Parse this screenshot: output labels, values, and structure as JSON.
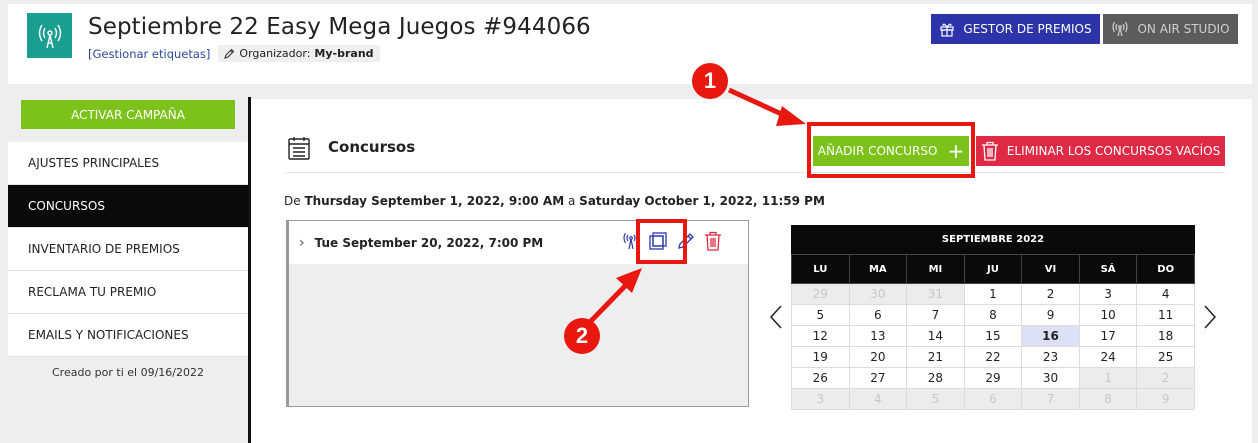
{
  "header": {
    "title": "Septiembre 22 Easy Mega Juegos #944066",
    "manage_tags": "[Gestionar etiquetas]",
    "organizer_label": "Organizador:",
    "organizer_name": "My-brand",
    "prize_manager_label": "GESTOR DE PREMIOS",
    "on_air_label": "ON AIR STUDIO",
    "logo_icon": "broadcast-tower-icon"
  },
  "sidebar": {
    "activate_label": "ACTIVAR CAMPAÑA",
    "items": [
      {
        "label": "AJUSTES PRINCIPALES",
        "active": false
      },
      {
        "label": "CONCURSOS",
        "active": true
      },
      {
        "label": "INVENTARIO DE PREMIOS",
        "active": false
      },
      {
        "label": "RECLAMA TU PREMIO",
        "active": false
      },
      {
        "label": "EMAILS Y NOTIFICACIONES",
        "active": false
      }
    ],
    "created": "Creado por ti el 09/16/2022"
  },
  "main": {
    "section_title": "Concursos",
    "add_contest_label": "AÑADIR CONCURSO",
    "delete_empty_label": "ELIMINAR LOS CONCURSOS VACÍOS",
    "range_prefix": "De",
    "range_start": "Thursday September 1, 2022, 9:00 AM",
    "range_mid": "a",
    "range_end": "Saturday October 1, 2022, 11:59 PM",
    "contest": {
      "date": "Tue September 20, 2022, 7:00 PM",
      "icons": [
        "broadcast-icon",
        "duplicate-icon",
        "edit-pencil-icon",
        "trash-icon"
      ]
    }
  },
  "calendar": {
    "title": "SEPTIEMBRE 2022",
    "weekdays": [
      "LU",
      "MA",
      "MI",
      "JU",
      "VI",
      "SÁ",
      "DO"
    ],
    "today": "16",
    "weeks": [
      [
        {
          "d": "29",
          "o": true
        },
        {
          "d": "30",
          "o": true
        },
        {
          "d": "31",
          "o": true
        },
        {
          "d": "1"
        },
        {
          "d": "2"
        },
        {
          "d": "3"
        },
        {
          "d": "4"
        }
      ],
      [
        {
          "d": "5"
        },
        {
          "d": "6"
        },
        {
          "d": "7"
        },
        {
          "d": "8"
        },
        {
          "d": "9"
        },
        {
          "d": "10"
        },
        {
          "d": "11"
        }
      ],
      [
        {
          "d": "12"
        },
        {
          "d": "13"
        },
        {
          "d": "14"
        },
        {
          "d": "15"
        },
        {
          "d": "16"
        },
        {
          "d": "17"
        },
        {
          "d": "18"
        }
      ],
      [
        {
          "d": "19"
        },
        {
          "d": "20"
        },
        {
          "d": "21"
        },
        {
          "d": "22"
        },
        {
          "d": "23"
        },
        {
          "d": "24"
        },
        {
          "d": "25"
        }
      ],
      [
        {
          "d": "26"
        },
        {
          "d": "27"
        },
        {
          "d": "28"
        },
        {
          "d": "29"
        },
        {
          "d": "30"
        },
        {
          "d": "1",
          "o": true
        },
        {
          "d": "2",
          "o": true
        }
      ],
      [
        {
          "d": "3",
          "o": true
        },
        {
          "d": "4",
          "o": true
        },
        {
          "d": "5",
          "o": true
        },
        {
          "d": "6",
          "o": true
        },
        {
          "d": "7",
          "o": true
        },
        {
          "d": "8",
          "o": true
        },
        {
          "d": "9",
          "o": true
        }
      ]
    ]
  },
  "annotations": {
    "badge1": "1",
    "badge2": "2",
    "color": "#e8170f"
  }
}
